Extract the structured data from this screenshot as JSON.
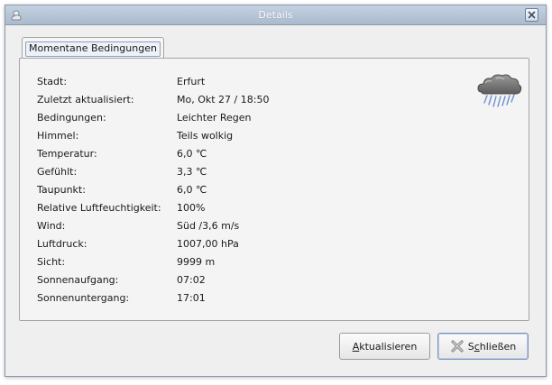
{
  "window": {
    "title": "Details",
    "app_icon": "weather-app-icon",
    "close_icon": "close-icon"
  },
  "tabs": [
    {
      "label": "Momentane Bedingungen",
      "active": true
    }
  ],
  "conditions": {
    "rows": [
      {
        "label": "Stadt:",
        "value": "Erfurt"
      },
      {
        "label": "Zuletzt aktualisiert:",
        "value": "Mo, Okt 27 / 18:50"
      },
      {
        "label": "Bedingungen:",
        "value": "Leichter Regen"
      },
      {
        "label": "Himmel:",
        "value": "Teils wolkig"
      },
      {
        "label": "Temperatur:",
        "value": "6,0 ℃"
      },
      {
        "label": "Gefühlt:",
        "value": "3,3 ℃"
      },
      {
        "label": "Taupunkt:",
        "value": "6,0 ℃"
      },
      {
        "label": "Relative Luftfeuchtigkeit:",
        "value": "100%"
      },
      {
        "label": "Wind:",
        "value": "Süd /3,6 m/s"
      },
      {
        "label": "Luftdruck:",
        "value": "1007,00 hPa"
      },
      {
        "label": "Sicht:",
        "value": "9999 m"
      },
      {
        "label": "Sonnenaufgang:",
        "value": "07:02"
      },
      {
        "label": "Sonnenuntergang:",
        "value": "17:01"
      }
    ],
    "weather_icon": "rain-cloud-icon"
  },
  "buttons": {
    "refresh_prefix": "",
    "refresh_mnemonic": "A",
    "refresh_rest": "ktualisieren",
    "close_prefix": "S",
    "close_mnemonic": "c",
    "close_rest": "hließen",
    "close_icon": "close-x-icon"
  },
  "colors": {
    "titlebar": "#aab9cc",
    "window_bg": "#efefef",
    "rain": "#5a7fc0"
  }
}
